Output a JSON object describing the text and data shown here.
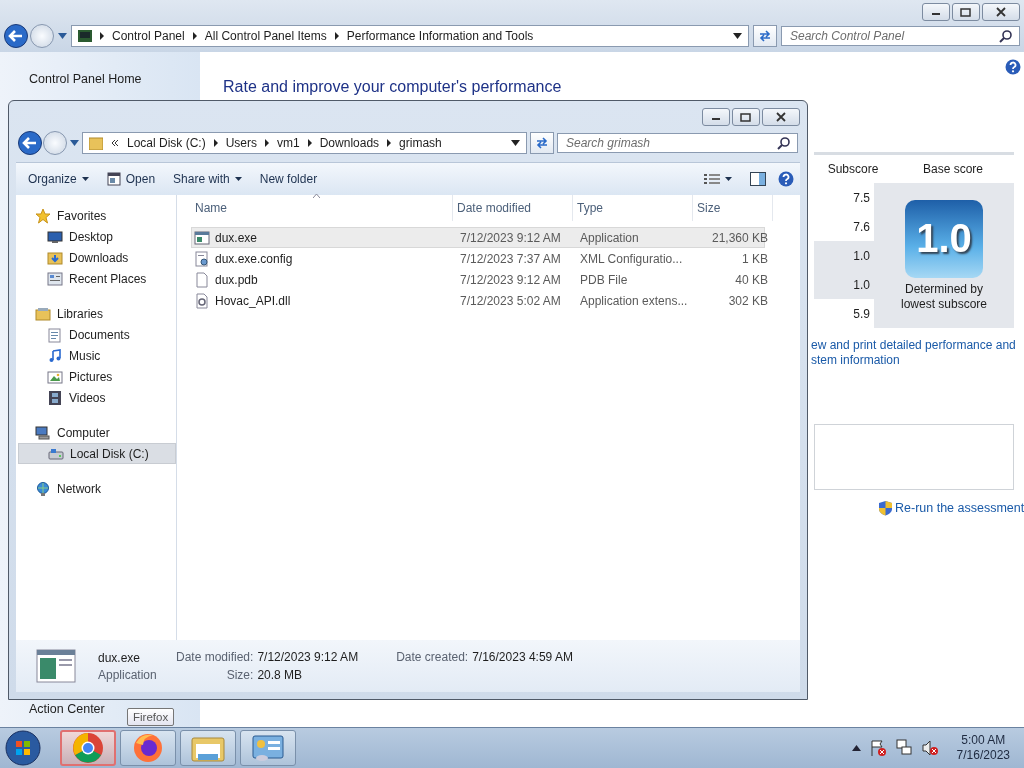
{
  "control_panel": {
    "breadcrumb": [
      "Control Panel",
      "All Control Panel Items",
      "Performance Information and Tools"
    ],
    "search_placeholder": "Search Control Panel",
    "sidebar": {
      "home_link": "Control Panel Home",
      "see_also": [
        "Action Center"
      ]
    },
    "heading": "Rate and improve your computer's performance",
    "score_table": {
      "columns": [
        "Subscore",
        "Base score"
      ],
      "subscores": [
        {
          "value": "7.5",
          "lowest": false
        },
        {
          "value": "7.6",
          "lowest": false
        },
        {
          "value": "1.0",
          "lowest": true
        },
        {
          "value": "1.0",
          "lowest": true
        },
        {
          "value": "5.9",
          "lowest": false
        }
      ],
      "base_score": "1.0",
      "base_note": "Determined by lowest subscore"
    },
    "details_link": "ew and print detailed performance and stem information",
    "rerun_link": "Re-run the assessment"
  },
  "explorer": {
    "breadcrumb": [
      "Local Disk (C:)",
      "Users",
      "vm1",
      "Downloads",
      "grimash"
    ],
    "search_placeholder": "Search grimash",
    "toolbar": [
      {
        "label": "Organize",
        "kind": "menu"
      },
      {
        "label": "Open",
        "kind": "open"
      },
      {
        "label": "Share with",
        "kind": "menu"
      },
      {
        "label": "New folder",
        "kind": "plain"
      }
    ],
    "nav": [
      {
        "label": "Favorites",
        "kind": "star",
        "children": [
          {
            "label": "Desktop",
            "kind": "desktop",
            "selected": false
          },
          {
            "label": "Downloads",
            "kind": "downloads",
            "selected": false
          },
          {
            "label": "Recent Places",
            "kind": "recent",
            "selected": false
          }
        ]
      },
      {
        "label": "Libraries",
        "kind": "library",
        "children": [
          {
            "label": "Documents",
            "kind": "documents",
            "selected": false
          },
          {
            "label": "Music",
            "kind": "music",
            "selected": false
          },
          {
            "label": "Pictures",
            "kind": "pictures",
            "selected": false
          },
          {
            "label": "Videos",
            "kind": "videos",
            "selected": false
          }
        ]
      },
      {
        "label": "Computer",
        "kind": "computer",
        "children": [
          {
            "label": "Local Disk (C:)",
            "kind": "disk",
            "selected": true
          }
        ]
      },
      {
        "label": "Network",
        "kind": "network"
      }
    ],
    "columns": [
      "Name",
      "Date modified",
      "Type",
      "Size"
    ],
    "files": [
      {
        "name": "dux.exe",
        "date": "7/12/2023 9:12 AM",
        "type": "Application",
        "size": "21,360 KB",
        "kind": "app",
        "selected": true
      },
      {
        "name": "dux.exe.config",
        "date": "7/12/2023 7:37 AM",
        "type": "XML Configuratio...",
        "size": "1 KB",
        "kind": "config",
        "selected": false
      },
      {
        "name": "dux.pdb",
        "date": "7/12/2023 9:12 AM",
        "type": "PDB File",
        "size": "40 KB",
        "kind": "blank",
        "selected": false
      },
      {
        "name": "Hovac_API.dll",
        "date": "7/12/2023 5:02 AM",
        "type": "Application extens...",
        "size": "302 KB",
        "kind": "dll",
        "selected": false
      }
    ],
    "details": {
      "name": "dux.exe",
      "type": "Application",
      "fields": [
        {
          "label": "Date modified:",
          "value": "7/12/2023 9:12 AM"
        },
        {
          "label": "Size:",
          "value": "20.8 MB"
        },
        {
          "label": "Date created:",
          "value": "7/16/2023 4:59 AM"
        }
      ]
    }
  },
  "taskbar": {
    "apps": [
      {
        "kind": "chrome",
        "selected": true
      },
      {
        "kind": "firefox",
        "selected": false
      },
      {
        "kind": "explorer",
        "selected": false
      },
      {
        "kind": "control-panel",
        "selected": false
      }
    ],
    "tooltip": "Firefox",
    "time": "5:00 AM",
    "date": "7/16/2023"
  }
}
